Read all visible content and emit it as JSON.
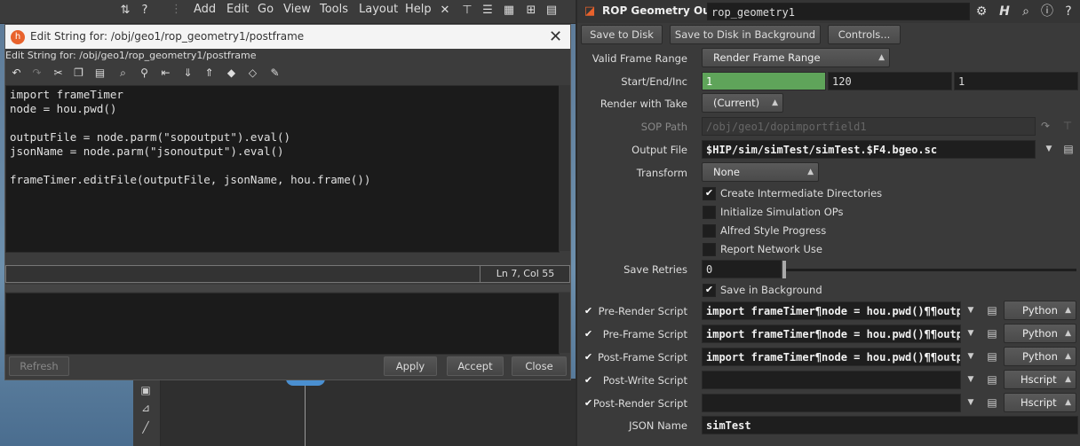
{
  "menubar": {
    "items": [
      "Add",
      "Edit",
      "Go",
      "View",
      "Tools",
      "Layout",
      "Help"
    ]
  },
  "dialog": {
    "title": "Edit String for: /obj/geo1/rop_geometry1/postframe",
    "subtitle": "Edit String for: /obj/geo1/rop_geometry1/postframe",
    "code": "import frameTimer\nnode = hou.pwd()\n\noutputFile = node.parm(\"sopoutput\").eval()\njsonName = node.parm(\"jsonoutput\").eval()\n\nframeTimer.editFile(outputFile, jsonName, hou.frame())",
    "cursor_pos": "Ln 7, Col 55",
    "buttons": {
      "refresh": "Refresh",
      "apply": "Apply",
      "accept": "Accept",
      "close": "Close"
    }
  },
  "params": {
    "node_type": "ROP Geometry Output",
    "node_name": "rop_geometry1",
    "buttons": {
      "save_to_disk": "Save to Disk",
      "save_bg": "Save to Disk in Background",
      "controls": "Controls..."
    },
    "valid_frame_range": {
      "label": "Valid Frame Range",
      "value": "Render Frame Range"
    },
    "start_end_inc": {
      "label": "Start/End/Inc",
      "start": "1",
      "end": "120",
      "inc": "1"
    },
    "render_with_take": {
      "label": "Render with Take",
      "value": "(Current)"
    },
    "sop_path": {
      "label": "SOP Path",
      "value": "/obj/geo1/dopimportfield1"
    },
    "output_file": {
      "label": "Output File",
      "value": "$HIP/sim/simTest/simTest.$F4.bgeo.sc"
    },
    "transform": {
      "label": "Transform",
      "value": "None"
    },
    "checks": {
      "create_dirs": "Create Intermediate Directories",
      "init_sim": "Initialize Simulation OPs",
      "alfred": "Alfred Style Progress",
      "report_net": "Report Network Use",
      "save_bg": "Save in Background"
    },
    "save_retries": {
      "label": "Save Retries",
      "value": "0"
    },
    "scripts": {
      "pre_render": {
        "label": "Pre-Render Script",
        "value": "import frameTimer¶node = hou.pwd()¶¶output",
        "lang": "Python"
      },
      "pre_frame": {
        "label": "Pre-Frame Script",
        "value": "import frameTimer¶node = hou.pwd()¶¶output",
        "lang": "Python"
      },
      "post_frame": {
        "label": "Post-Frame Script",
        "value": "import frameTimer¶node = hou.pwd()¶¶output",
        "lang": "Python"
      },
      "post_write": {
        "label": "Post-Write Script",
        "value": "",
        "lang": "Hscript"
      },
      "post_render": {
        "label": "Post-Render Script",
        "value": "",
        "lang": "Hscript"
      }
    },
    "json_name": {
      "label": "JSON Name",
      "value": "simTest"
    }
  }
}
